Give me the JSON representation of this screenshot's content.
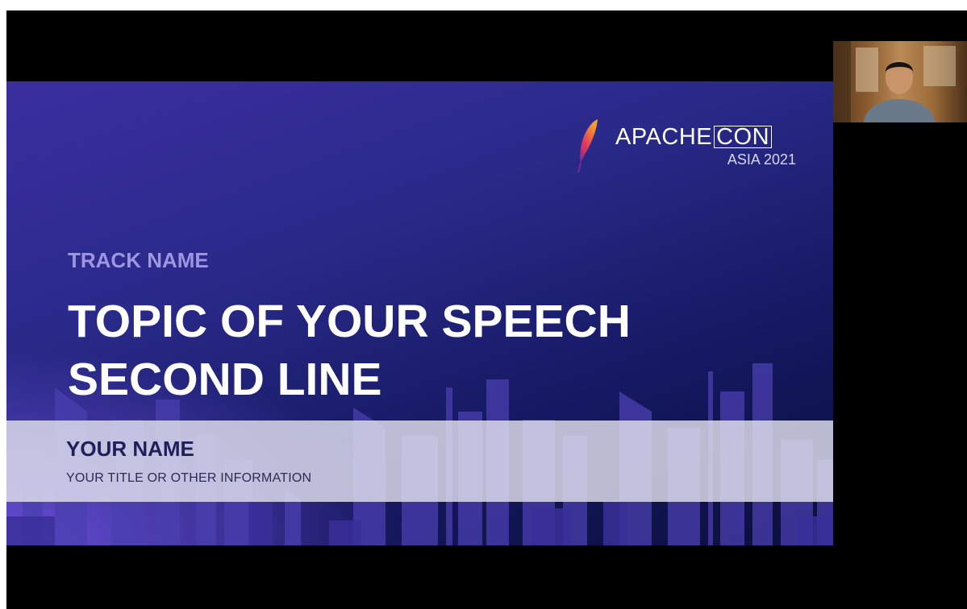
{
  "slide": {
    "logo": {
      "brand": "APACHE",
      "brand_suffix": "CON",
      "edition": "ASIA 2021"
    },
    "track_name": "TRACK NAME",
    "topic_line1": "TOPIC OF YOUR SPEECH",
    "topic_line2": "SECOND LINE",
    "speaker_name": "YOUR NAME",
    "speaker_info": "YOUR TITLE  OR OTHER INFORMATION"
  },
  "colors": {
    "slide_dark": "#0c0f3c",
    "slide_purple": "#3b2ea0",
    "track_text": "#9d97e2",
    "name_text": "#1f1f5a"
  },
  "webcam": {
    "icon": "person-video-thumbnail"
  }
}
